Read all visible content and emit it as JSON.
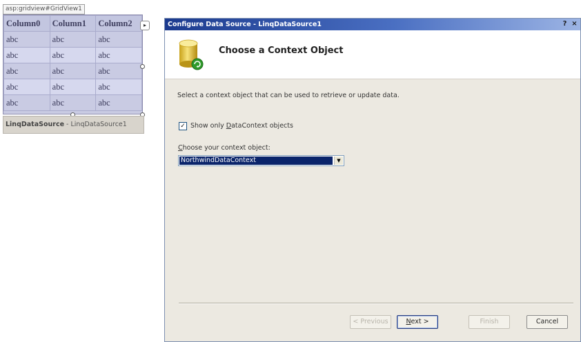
{
  "designer": {
    "gridview_tag": "asp:gridview#GridView1",
    "gridview": {
      "columns": [
        "Column0",
        "Column1",
        "Column2"
      ],
      "rows": [
        [
          "abc",
          "abc",
          "abc"
        ],
        [
          "abc",
          "abc",
          "abc"
        ],
        [
          "abc",
          "abc",
          "abc"
        ],
        [
          "abc",
          "abc",
          "abc"
        ],
        [
          "abc",
          "abc",
          "abc"
        ]
      ]
    },
    "datasource": {
      "type_label": "LinqDataSource",
      "separator": " - ",
      "id_label": "LinqDataSource1"
    }
  },
  "dialog": {
    "title": "Configure Data Source - LinqDataSource1",
    "help_glyph": "?",
    "close_glyph": "×",
    "header_title": "Choose a Context Object",
    "description": "Select a context object that can be used to retrieve or update data.",
    "checkbox": {
      "checked": true,
      "label_prefix": "Show only ",
      "label_underlined": "D",
      "label_suffix": "ataContext objects"
    },
    "choose": {
      "label_underlined": "C",
      "label_rest": "hoose your context object:",
      "selected_value": "NorthwindDataContext"
    },
    "buttons": {
      "previous": "< Previous",
      "next_underlined": "N",
      "next_rest": "ext >",
      "finish": "Finish",
      "cancel": "Cancel"
    }
  },
  "colors": {
    "title_bar_start": "#1b3a8e",
    "selection": "#0a246a",
    "grid_bg": "#c9cbe3"
  },
  "icons": {
    "database": "database-icon",
    "refresh_badge": "refresh-icon",
    "dropdown": "chevron-down-icon",
    "smart_tag": "chevron-right-icon"
  }
}
